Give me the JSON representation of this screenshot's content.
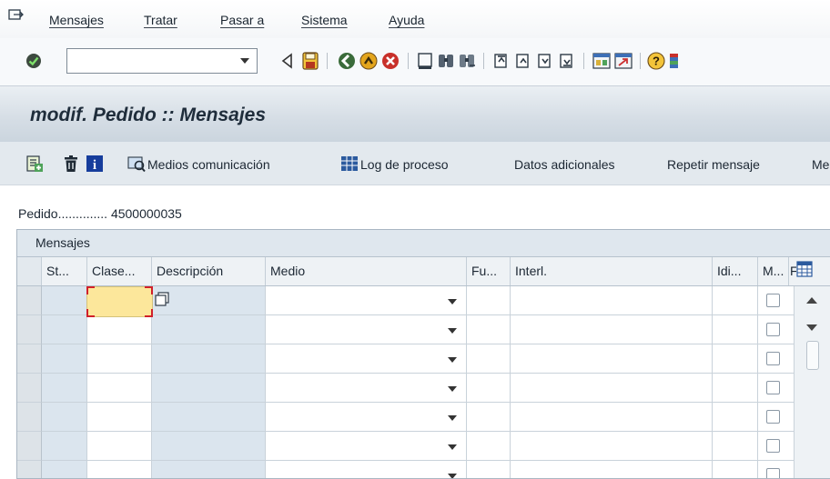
{
  "menu": {
    "items": [
      {
        "label": "Mensajes"
      },
      {
        "label": "Tratar"
      },
      {
        "label": "Pasar a"
      },
      {
        "label": "Sistema"
      },
      {
        "label": "Ayuda"
      }
    ]
  },
  "toolbar": {
    "command_field_value": "",
    "icons": [
      "enter-icon",
      "back-triangle-icon",
      "save-icon",
      "back-icon",
      "exit-icon",
      "cancel-icon",
      "print-icon",
      "find-icon",
      "find-next-icon",
      "first-page-icon",
      "previous-page-icon",
      "next-page-icon",
      "last-page-icon",
      "new-session-icon",
      "shortcut-icon",
      "help-icon",
      "layout-menu-icon"
    ]
  },
  "title": "modif. Pedido :: Mensajes",
  "app_toolbar": {
    "icons": [
      "new-entries-icon",
      "delete-icon",
      "info-icon"
    ],
    "medios_label": "Medios comunicación",
    "log_label": "Log de proceso",
    "datos_label": "Datos adicionales",
    "repetir_label": "Repetir mensaje",
    "more_label": "Me"
  },
  "pedido": {
    "label": "Pedido..............",
    "number": "4500000035"
  },
  "table": {
    "title": "Mensajes",
    "columns": [
      "St...",
      "Clase...",
      "Descripción",
      "Medio",
      "Fu...",
      "Interl.",
      "Idi...",
      "M...",
      "F"
    ],
    "visible_rows": 7
  },
  "colors": {
    "title_bar": "#d5dde5",
    "focus_cell": "#fce79b",
    "focus_border": "#d0202a"
  }
}
